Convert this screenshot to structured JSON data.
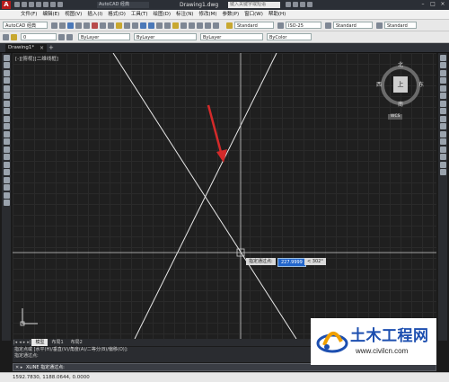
{
  "window": {
    "app_logo": "A",
    "workspace": "AutoCAD 经典",
    "document_title": "Drawing1.dwg",
    "search_placeholder": "键入关键字或短语",
    "minimize": "–",
    "maximize": "□",
    "close": "×"
  },
  "menu": {
    "items": [
      "文件(F)",
      "编辑(E)",
      "视图(V)",
      "插入(I)",
      "格式(O)",
      "工具(T)",
      "绘图(D)",
      "标注(N)",
      "修改(M)",
      "参数(P)",
      "窗口(W)",
      "帮助(H)"
    ]
  },
  "toolbar": {
    "workspace_combo": "AutoCAD 经典",
    "text_style": "Standard",
    "dim_style": "ISO-25",
    "table_style": "Standard",
    "multileader_style": "Standard",
    "layer_combo": "0",
    "color_combo": "ByLayer",
    "linetype_combo": "ByLayer",
    "lineweight_combo": "ByLayer",
    "plotstyle_combo": "ByColor"
  },
  "tabs": {
    "document_tab": "Drawing1*",
    "close_icon": "×",
    "new_tab": "+"
  },
  "viewport": {
    "label": "[-][俯视][二维线框]",
    "viewcube": {
      "face": "上",
      "north": "北",
      "south": "南",
      "east": "东",
      "west": "西"
    },
    "wcs_badge": "WCS"
  },
  "dynamic_input": {
    "prompt": "指定通过点:",
    "distance": "227.9999",
    "angle": "< 302°"
  },
  "layout_tabs": {
    "items": [
      "模型",
      "布局1",
      "布局2"
    ],
    "active": "模型"
  },
  "command": {
    "history": [
      "指定点或 [水平(H)/垂直(V)/角度(A)/二等分(B)/偏移(O)]:",
      "指定通过点:"
    ],
    "current": "XLINE 指定通过点:"
  },
  "status": {
    "coordinates": "1592.7830, 1188.0644, 0.0000"
  },
  "watermark": {
    "brand": "土木工程网",
    "url": "www.civilcn.com"
  },
  "colors": {
    "canvas": "#1f1f1f",
    "construction_line": "#e8e8e8",
    "arrow": "#d42a2a",
    "watermark_blue": "#1d4fb0"
  }
}
